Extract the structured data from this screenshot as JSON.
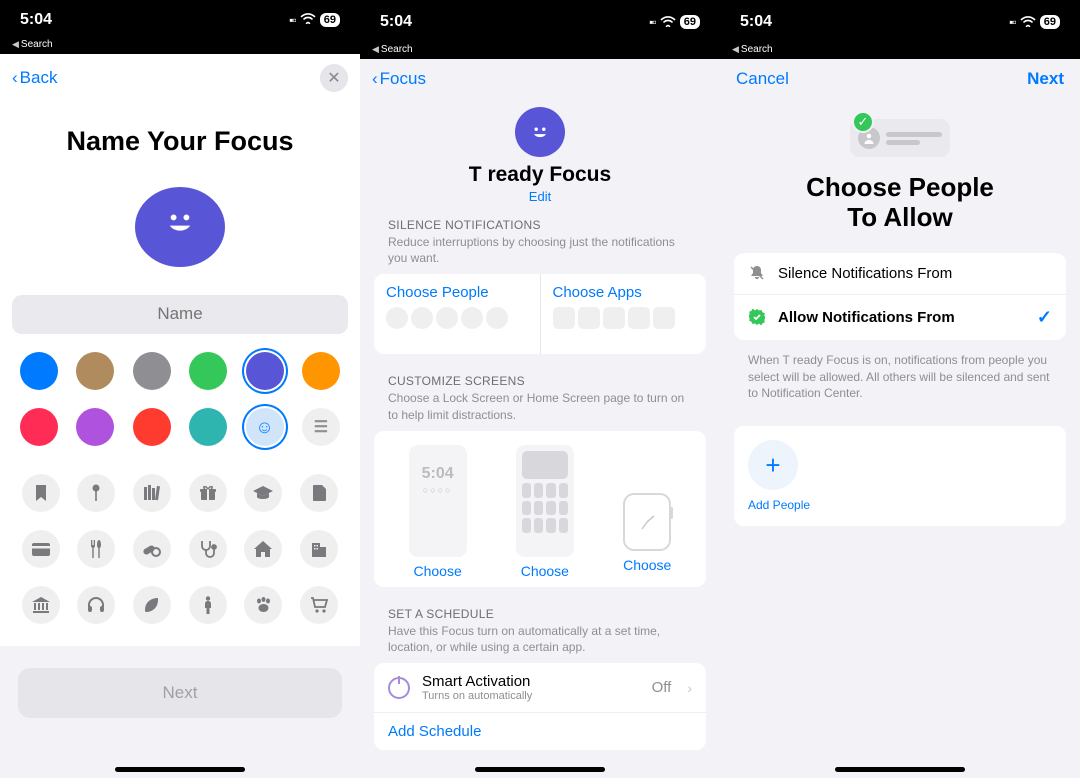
{
  "status": {
    "time": "5:04",
    "battery": "69",
    "breadcrumb": "Search"
  },
  "screen1": {
    "back": "Back",
    "title": "Name Your Focus",
    "name_placeholder": "Name",
    "colors": [
      "#007aff",
      "#b08b5e",
      "#8e8e93",
      "#34c759",
      "#5856d6",
      "#ff9500",
      "#ff2d55",
      "#af52de",
      "#ff3b30",
      "#2fb5b0"
    ],
    "selected_color_index": 4,
    "icons": [
      "bookmark",
      "pin",
      "books",
      "gift",
      "grad-cap",
      "document",
      "card",
      "utensils",
      "pills",
      "stethoscope",
      "house",
      "building",
      "bank",
      "headphones",
      "leaf",
      "person",
      "paw",
      "cart"
    ],
    "next": "Next"
  },
  "screen2": {
    "back": "Focus",
    "focus_name": "T ready Focus",
    "edit": "Edit",
    "silence_header": "SILENCE NOTIFICATIONS",
    "silence_sub": "Reduce interruptions by choosing just the notifications you want.",
    "choose_people": "Choose People",
    "choose_apps": "Choose Apps",
    "customize_header": "CUSTOMIZE SCREENS",
    "customize_sub": "Choose a Lock Screen or Home Screen page to turn on to help limit distractions.",
    "preview_time": "5:04",
    "choose": "Choose",
    "schedule_header": "SET A SCHEDULE",
    "schedule_sub": "Have this Focus turn on automatically at a set time, location, or while using a certain app.",
    "smart_activation": "Smart Activation",
    "smart_sub": "Turns on automatically",
    "off": "Off",
    "add_schedule": "Add Schedule"
  },
  "screen3": {
    "cancel": "Cancel",
    "next": "Next",
    "title_line1": "Choose People",
    "title_line2": "To Allow",
    "opt_silence": "Silence Notifications From",
    "opt_allow": "Allow Notifications From",
    "note": "When T ready Focus is on, notifications from people you select will be allowed. All others will be silenced and sent to Notification Center.",
    "add_people": "Add People"
  }
}
